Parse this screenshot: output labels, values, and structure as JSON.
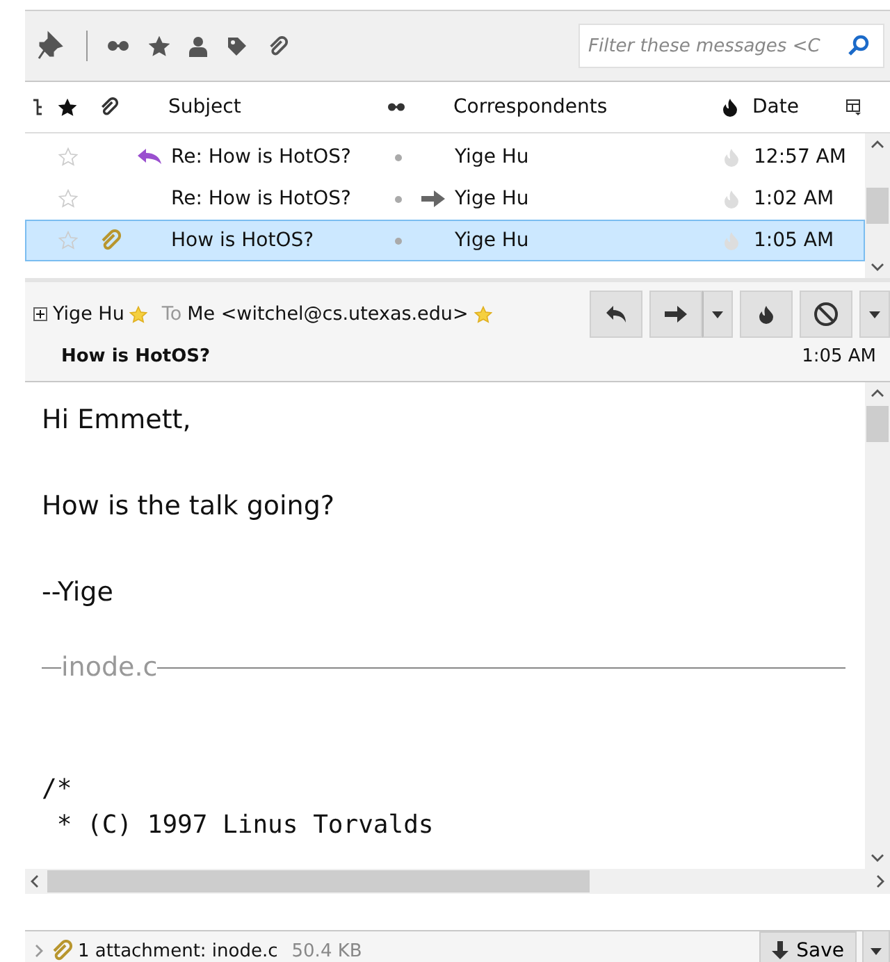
{
  "filter": {
    "placeholder": "Filter these messages <C"
  },
  "columns": [
    "Subject",
    "Correspondents",
    "Date"
  ],
  "messages": [
    {
      "subject": "Re: How is HotOS?",
      "correspondent": "Yige Hu",
      "date": "12:57 AM",
      "starred": false,
      "replied": true,
      "forwarded": false,
      "attachment": false,
      "selected": false
    },
    {
      "subject": "Re: How is HotOS?",
      "correspondent": "Yige Hu",
      "date": "1:02 AM",
      "starred": false,
      "replied": false,
      "forwarded": true,
      "attachment": false,
      "selected": false
    },
    {
      "subject": "How is HotOS?",
      "correspondent": "Yige Hu",
      "date": "1:05 AM",
      "starred": false,
      "replied": false,
      "forwarded": false,
      "attachment": true,
      "selected": true
    }
  ],
  "header": {
    "from": "Yige Hu",
    "to_label": "To",
    "to": "Me <witchel@cs.utexas.edu>",
    "subject": "How is HotOS?",
    "date": "1:05 AM"
  },
  "body": [
    "Hi Emmett,",
    "How is the talk going?",
    "--Yige"
  ],
  "attachment_divider": "inode.c",
  "code": [
    "/*",
    " * (C) 1997 Linus Torvalds"
  ],
  "attachment_bar": {
    "summary": "1 attachment: inode.c",
    "size": "50.4 KB",
    "save": "Save"
  }
}
